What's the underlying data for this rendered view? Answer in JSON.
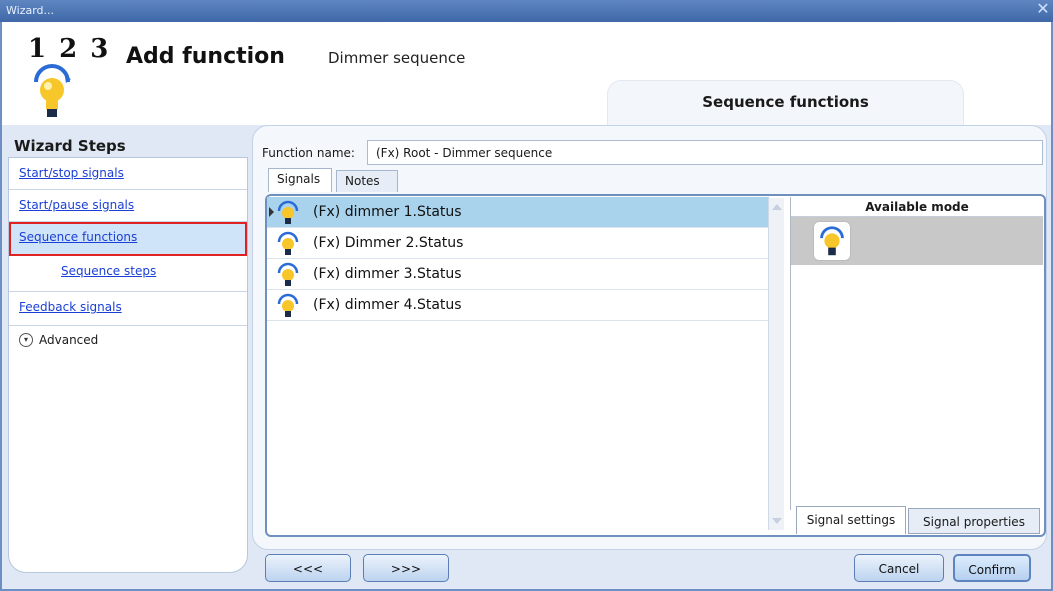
{
  "window": {
    "title": "Wizard...",
    "close_glyph": "✕"
  },
  "header": {
    "logo_numbers": "1 2 3",
    "title": "Add function",
    "subtitle": "Dimmer sequence",
    "tab_label": "Sequence functions"
  },
  "steps": {
    "title": "Wizard Steps",
    "items": [
      {
        "label": "Start/stop signals"
      },
      {
        "label": "Start/pause signals"
      },
      {
        "label": "Sequence functions"
      },
      {
        "label": "Sequence steps"
      },
      {
        "label": "Feedback signals"
      }
    ],
    "advanced_label": "Advanced"
  },
  "function": {
    "name_label": "Function name:",
    "name_value": "(Fx) Root - Dimmer sequence"
  },
  "tabs": [
    {
      "label": "Signals"
    },
    {
      "label": "Notes"
    }
  ],
  "signals": [
    {
      "label": "(Fx) dimmer 1.Status",
      "icon": "dimmer-bulb-icon"
    },
    {
      "label": "(Fx) Dimmer 2.Status",
      "icon": "dimmer-bulb-icon"
    },
    {
      "label": "(Fx) dimmer 3.Status",
      "icon": "dimmer-bulb-icon"
    },
    {
      "label": "(Fx) dimmer 4.Status",
      "icon": "dimmer-bulb-icon"
    }
  ],
  "mode": {
    "header": "Available mode",
    "icon": "dimmer-bulb-icon",
    "tab_settings": "Signal settings",
    "tab_properties": "Signal properties"
  },
  "nav": {
    "back": "<<<",
    "next": ">>>"
  },
  "actions": {
    "cancel": "Cancel",
    "confirm": "Confirm"
  },
  "colors": {
    "accent": "#4f78b5",
    "selected_row": "#a9d3ec",
    "highlight_border": "#e12222",
    "link": "#1a3fd6"
  }
}
